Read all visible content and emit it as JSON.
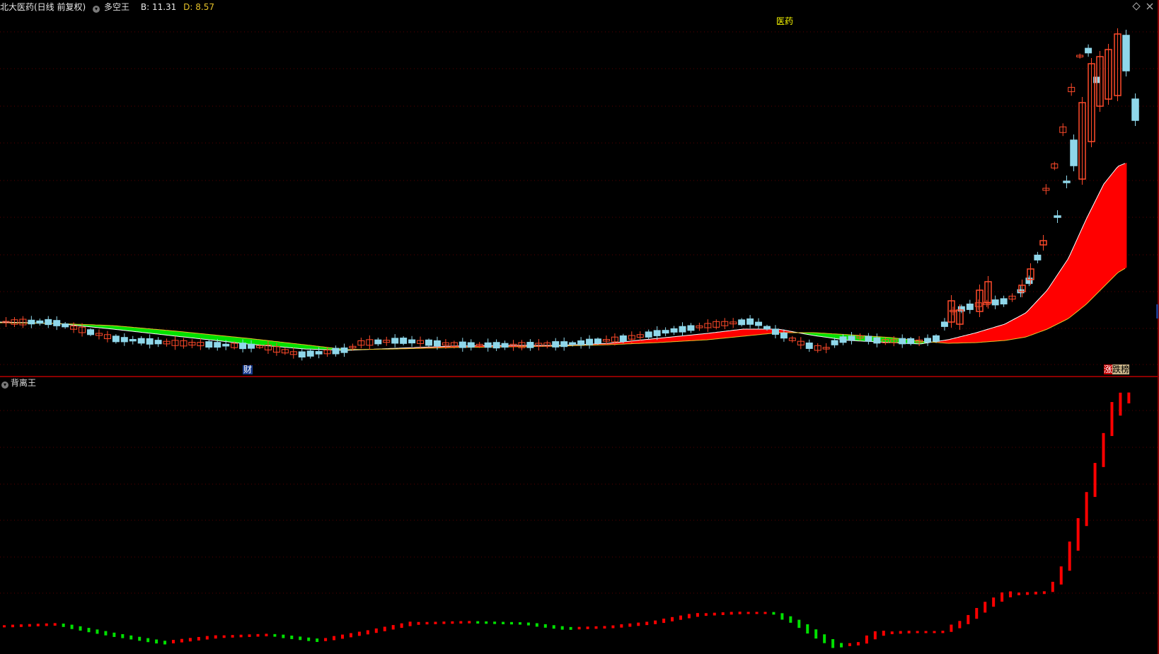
{
  "header": {
    "stock_title": "北大医药(日线 前复权)",
    "indicator_name": "多空王",
    "b_label": "B: 11.31",
    "d_label": "D: 8.57"
  },
  "main_panel": {
    "sector_label": "医药",
    "finance_marker": "财",
    "limit_tag_up": "涨",
    "limit_tag_list": "跌榜"
  },
  "sub_panel": {
    "title": "背离王"
  },
  "colors": {
    "up_candle": "#ff4a2a",
    "down_candle": "#8fd7ea",
    "band_bull": "#ff0000",
    "band_bear": "#00e000",
    "grid": "#5a0000",
    "b_color": "#e8e8e8",
    "d_color": "#e6c229",
    "sector_color": "#ffff00"
  }
}
